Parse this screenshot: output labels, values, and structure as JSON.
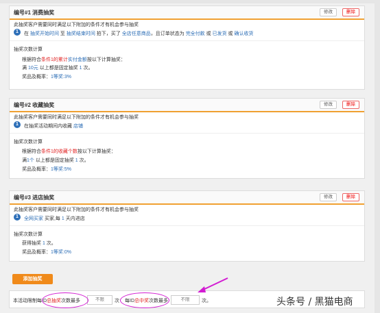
{
  "rules": [
    {
      "title": "编号#1 消费抽奖",
      "edit_label": "修改",
      "delete_label": "删除",
      "condition_intro": "此抽奖客户需要同时满足以下附加的条件才有机会参与抽奖",
      "condition_number": "1",
      "condition_parts": [
        {
          "text": "在 ",
          "cls": ""
        },
        {
          "text": "抽奖开始时间",
          "cls": "blue"
        },
        {
          "text": " 至 ",
          "cls": ""
        },
        {
          "text": "抽奖结束时间",
          "cls": "blue"
        },
        {
          "text": " 拍下，买了 ",
          "cls": ""
        },
        {
          "text": "全店任意商品",
          "cls": "blue"
        },
        {
          "text": "，且订单状态为 ",
          "cls": ""
        },
        {
          "text": "完全付款",
          "cls": "blue"
        },
        {
          "text": " 或 ",
          "cls": ""
        },
        {
          "text": "已发货",
          "cls": "blue"
        },
        {
          "text": " 或 ",
          "cls": ""
        },
        {
          "text": "确认收货",
          "cls": "blue"
        }
      ],
      "count_title": "抽奖次数计算",
      "count_rule_parts": [
        {
          "text": "根据符合",
          "cls": ""
        },
        {
          "text": "条件1的累计",
          "cls": "red"
        },
        {
          "text": "实付金额",
          "cls": "blue"
        },
        {
          "text": "按以下计算抽奖：",
          "cls": ""
        }
      ],
      "count_detail_parts": [
        {
          "text": "满 ",
          "cls": ""
        },
        {
          "text": "10元",
          "cls": "blue"
        },
        {
          "text": " 以上都是固定抽奖 ",
          "cls": ""
        },
        {
          "text": "1",
          "cls": "blue"
        },
        {
          "text": " 次。",
          "cls": ""
        }
      ],
      "prize_label": "奖品及概率：",
      "prize_value": "1等奖:3%"
    },
    {
      "title": "编号#2 收藏抽奖",
      "edit_label": "修改",
      "delete_label": "删除",
      "condition_intro": "此抽奖客户需要同时满足以下附加的条件才有机会参与抽奖",
      "condition_number": "1",
      "condition_parts": [
        {
          "text": "在抽奖活动期间内收藏 ",
          "cls": ""
        },
        {
          "text": "店铺",
          "cls": "blue"
        }
      ],
      "count_title": "抽奖次数计算",
      "count_rule_parts": [
        {
          "text": "根据符合",
          "cls": ""
        },
        {
          "text": "条件1的收藏个数",
          "cls": "red"
        },
        {
          "text": "按以下计算抽奖：",
          "cls": ""
        }
      ],
      "count_detail_parts": [
        {
          "text": "满",
          "cls": ""
        },
        {
          "text": "1个",
          "cls": "blue"
        },
        {
          "text": " 以上都是固定抽奖 ",
          "cls": ""
        },
        {
          "text": "1",
          "cls": "blue"
        },
        {
          "text": " 次。",
          "cls": ""
        }
      ],
      "prize_label": "奖品及概率：",
      "prize_value": "1等奖:5%"
    },
    {
      "title": "编号#3 进店抽奖",
      "edit_label": "修改",
      "delete_label": "删除",
      "condition_intro": "此抽奖客户需要同时满足以下附加的条件才有机会参与抽奖",
      "condition_number": "1",
      "condition_parts": [
        {
          "text": "全网买家",
          "cls": "blue"
        },
        {
          "text": " 买家,每 ",
          "cls": ""
        },
        {
          "text": "1",
          "cls": "blue"
        },
        {
          "text": " 天内进店",
          "cls": ""
        }
      ],
      "count_title": "抽奖次数计算",
      "count_rule_parts": [],
      "count_detail_parts": [
        {
          "text": "获得抽奖 ",
          "cls": ""
        },
        {
          "text": "1",
          "cls": "blue"
        },
        {
          "text": " 次。",
          "cls": ""
        }
      ],
      "prize_label": "奖品及概率：",
      "prize_value": "1等奖:0%"
    }
  ],
  "add_button_label": "添加抽奖",
  "footer": {
    "part1_a": "本活动限制每ID",
    "part1_b": "总抽奖",
    "part1_c": "次数最多",
    "input1_value": "不限",
    "unit1": "次",
    "part2_a": "每ID",
    "part2_b": "总中奖",
    "part2_c": "次数最多",
    "input2_value": "不限",
    "unit2": "次。"
  },
  "watermark": "头条号 / 黑猫电商",
  "colors": {
    "accent_orange": "#f08a1a",
    "link_blue": "#2a6cb5",
    "annotation_magenta": "#d21bd2"
  }
}
